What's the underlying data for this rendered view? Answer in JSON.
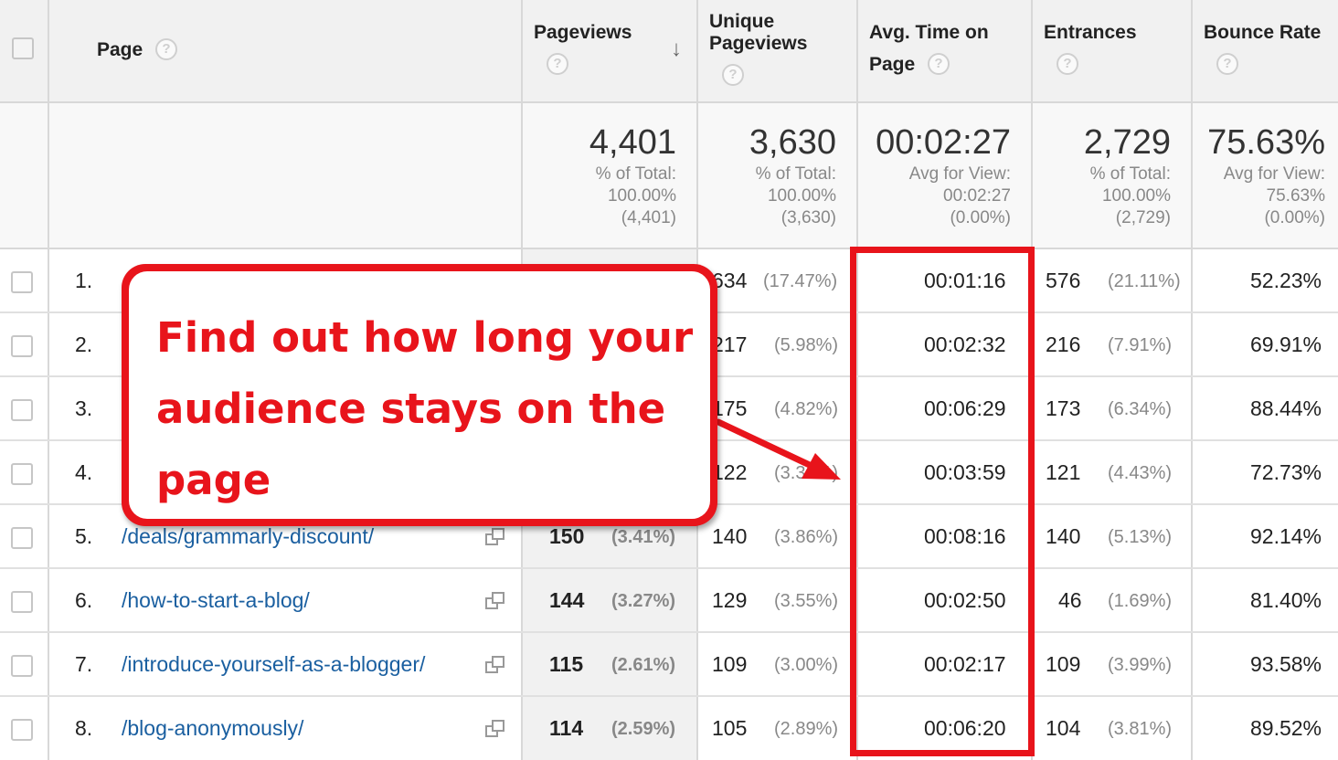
{
  "header": {
    "page_label": "Page",
    "pageviews_label": "Pageviews",
    "unique_label_1": "Unique",
    "unique_label_2": "Pageviews",
    "avgtime_label_1": "Avg. Time on",
    "avgtime_label_2": "Page",
    "entrances_label": "Entrances",
    "bounce_label": "Bounce Rate",
    "help_glyph": "?",
    "sort_glyph": "↓"
  },
  "totals": {
    "pageviews": {
      "value": "4,401",
      "sub1": "% of Total:",
      "sub2": "100.00%",
      "sub3": "(4,401)"
    },
    "unique": {
      "value": "3,630",
      "sub1": "% of Total:",
      "sub2": "100.00%",
      "sub3": "(3,630)"
    },
    "avgtime": {
      "value": "00:02:27",
      "sub1": "Avg for View:",
      "sub2": "00:02:27",
      "sub3": "(0.00%)"
    },
    "entrances": {
      "value": "2,729",
      "sub1": "% of Total:",
      "sub2": "100.00%",
      "sub3": "(2,729)"
    },
    "bounce": {
      "value": "75.63%",
      "sub1": "Avg for View:",
      "sub2": "75.63%",
      "sub3": "(0.00%)"
    }
  },
  "rows": [
    {
      "num": "1.",
      "page": "",
      "pageviews": "",
      "pv_pct": "",
      "unique": "634",
      "unique_pct": "(17.47%)",
      "avgtime": "00:01:16",
      "entrances": "576",
      "ent_pct": "(21.11%)",
      "bounce": "52.23%"
    },
    {
      "num": "2.",
      "page": "",
      "pageviews": "",
      "pv_pct": "",
      "unique": "217",
      "unique_pct": "(5.98%)",
      "avgtime": "00:02:32",
      "entrances": "216",
      "ent_pct": "(7.91%)",
      "bounce": "69.91%"
    },
    {
      "num": "3.",
      "page": "",
      "pageviews": "",
      "pv_pct": "",
      "unique": "175",
      "unique_pct": "(4.82%)",
      "avgtime": "00:06:29",
      "entrances": "173",
      "ent_pct": "(6.34%)",
      "bounce": "88.44%"
    },
    {
      "num": "4.",
      "page": "",
      "pageviews": "",
      "pv_pct": "",
      "unique": "122",
      "unique_pct": "(3.36%)",
      "avgtime": "00:03:59",
      "entrances": "121",
      "ent_pct": "(4.43%)",
      "bounce": "72.73%"
    },
    {
      "num": "5.",
      "page": "/deals/grammarly-discount/",
      "pageviews": "150",
      "pv_pct": "(3.41%)",
      "unique": "140",
      "unique_pct": "(3.86%)",
      "avgtime": "00:08:16",
      "entrances": "140",
      "ent_pct": "(5.13%)",
      "bounce": "92.14%"
    },
    {
      "num": "6.",
      "page": "/how-to-start-a-blog/",
      "pageviews": "144",
      "pv_pct": "(3.27%)",
      "unique": "129",
      "unique_pct": "(3.55%)",
      "avgtime": "00:02:50",
      "entrances": "46",
      "ent_pct": "(1.69%)",
      "bounce": "81.40%"
    },
    {
      "num": "7.",
      "page": "/introduce-yourself-as-a-blogger/",
      "pageviews": "115",
      "pv_pct": "(2.61%)",
      "unique": "109",
      "unique_pct": "(3.00%)",
      "avgtime": "00:02:17",
      "entrances": "109",
      "ent_pct": "(3.99%)",
      "bounce": "93.58%"
    },
    {
      "num": "8.",
      "page": "/blog-anonymously/",
      "pageviews": "114",
      "pv_pct": "(2.59%)",
      "unique": "105",
      "unique_pct": "(2.89%)",
      "avgtime": "00:06:20",
      "entrances": "104",
      "ent_pct": "(3.81%)",
      "bounce": "89.52%"
    }
  ],
  "callout": {
    "text": "Find out how long your audience stays on the page"
  },
  "colors": {
    "accent_red": "#e8141b",
    "link_blue": "#1a5fa0",
    "header_bg": "#f1f1f1"
  }
}
